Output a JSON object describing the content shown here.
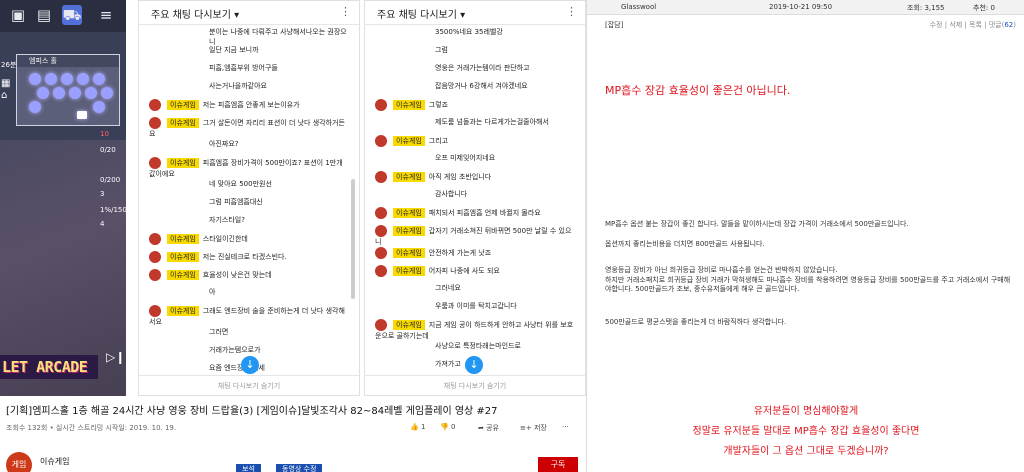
{
  "game": {
    "map_title": "엠피스 홀",
    "left_num": "26분",
    "side_values": [
      "10",
      "0/20",
      "0/200",
      "3",
      "1%/150",
      "4"
    ],
    "logo_text": "LET ARCADE",
    "accent": "#f4e27a"
  },
  "chat1": {
    "header": "주요 채팅 다시보기",
    "footer": "채팅 다시보기 숨기기",
    "messages": [
      {
        "name": "",
        "text": "분이는 나중에 다뤄주고 사냥해서나오는 권장으니"
      },
      {
        "name": "",
        "text": "일단 지금 보니까"
      },
      {
        "name": "",
        "text": "피흡,엠흡부위 방어구들"
      },
      {
        "name": "",
        "text": "사는거나을까같아요"
      },
      {
        "name": "이슈게임",
        "text": "저는 피흡엠흡 안좋게 보는이유가"
      },
      {
        "name": "이슈게임",
        "text": "그거 살돈이면 자리리 표션이 더 낫다 생각하거든요"
      },
      {
        "name": "",
        "text": "아진짜요?"
      },
      {
        "name": "이슈게임",
        "text": "피흡엠흡 장비가격이 500만이죠? 표션이 1만개값이에요"
      },
      {
        "name": "",
        "text": "네 맞아요 500만원선"
      },
      {
        "name": "",
        "text": "그럼 피흡엠흡대신"
      },
      {
        "name": "",
        "text": "자기스타일?"
      },
      {
        "name": "이슈게임",
        "text": "스타일이긴한데"
      },
      {
        "name": "이슈게임",
        "text": "저는 진실테크로 타겠스빈다."
      },
      {
        "name": "이슈게임",
        "text": "효율성이 낮은건 맞는데"
      },
      {
        "name": "",
        "text": "아"
      },
      {
        "name": "이슈게임",
        "text": "그래도 엔드장비 술을 준비하는게 더 낫다 생각해서요"
      },
      {
        "name": "",
        "text": "그러면"
      },
      {
        "name": "",
        "text": "거래가는템으로가"
      },
      {
        "name": "",
        "text": "요즘 엔드장비 시세"
      }
    ]
  },
  "chat2": {
    "header": "주요 채팅 다시보기",
    "footer": "채팅 다시보기 숨기기",
    "messages": [
      {
        "name": "",
        "text": "3500%네요 35레벨강"
      },
      {
        "name": "",
        "text": "그럼"
      },
      {
        "name": "",
        "text": "영웅은 거래가는템이라 판단하고"
      },
      {
        "name": "",
        "text": "잡음망거나 6강해서 겨야겠네요"
      },
      {
        "name": "이슈게임",
        "text": "그렇죠"
      },
      {
        "name": "",
        "text": "제도룸 넘돌과는 다르게가는걸줄아해서"
      },
      {
        "name": "이슈게임",
        "text": "그리고"
      },
      {
        "name": "",
        "text": "오프 미제잊어지네요"
      },
      {
        "name": "이슈게임",
        "text": "아직 게임 초반입니다"
      },
      {
        "name": "",
        "text": "감사합니다"
      },
      {
        "name": "이슈게임",
        "text": "패치되서 피흡엠흡 언제 바뀔지 몰라요"
      },
      {
        "name": "이슈게임",
        "text": "갑자기 거래소쳐진 뒤바뀌면 500만 날릴 수 있으니"
      },
      {
        "name": "이슈게임",
        "text": "안전하게 가는게 낫죠"
      },
      {
        "name": "이슈게임",
        "text": "어자피 나중에 사도 되요"
      },
      {
        "name": "",
        "text": "그러네요"
      },
      {
        "name": "",
        "text": "우룸과 이미를 탁치고갑니다"
      },
      {
        "name": "이슈게임",
        "text": "지금 게임 공이 하드하게 안하고 사냥터 위를 보호운으로 골하기는데"
      },
      {
        "name": "",
        "text": "사냥으로 특정타래는마인드로"
      },
      {
        "name": "",
        "text": "가져가고"
      }
    ]
  },
  "video": {
    "title": "[기획]엠피스홀 1층 해골 24시간 사냥 영웅 장비 드랍율(3) [게임이슈]달빛조각사 82~84레벨 게임플레이 영상 #27",
    "meta": "조회수 132회 • 실시간 스트리밍 시작일: 2019. 10. 19.",
    "likes": "1",
    "dislikes": "0",
    "share": "공유",
    "save": "저장",
    "more": "···",
    "channel_name": "이슈게임",
    "channel_avatar": "게임",
    "btn_a": "보석",
    "btn_b": "동영상 수정",
    "subscribe": "구독"
  },
  "post": {
    "author": "Glasswool",
    "date": "2019-10-21 09:50",
    "views": "조회: 3,155",
    "recommend": "추천: 0",
    "actions": [
      "수정",
      "삭제",
      "목록",
      "댓글"
    ],
    "comment_count": "62",
    "tag": "[잡담]",
    "headline": "MP흡수 장감 효율성이 좋은건 아닙니다.",
    "paragraphs": [
      "MP흡수 옵션 붙는 장갑이 좋긴 합니다. 말들을 맡이하시는데 장갑 가격이 거래소에서 500만골드입니다.",
      "옵션까지 좋리는비용을 더치면 800만골드 사용됩니다.",
      "영웅등급 장비가 아닌 희귀등급 장비로 마나흡수를 얻는건 반박하지 않았습니다.",
      "하지만 거래소패치로 희귀등급 장비 거래가 막혀생해도 마나흡수 장비를 착용하려면 영웅등급 장비를 500만골드를 주고 거래소에서 구매해야합니다. 500만골드가 조보, 중수유저들에게 해우 큰 골드입니다.",
      "500만골드로 평균스탯을 좋리는게 더 바람직하다 생각합니다."
    ],
    "closing": [
      "유저분들이 명심해야할게",
      "정말로 유저분들 말대로 MP흡수 장갑 효율성이 좋다면",
      "개발자들이 그 옵션 그대로 두겠습니까?"
    ],
    "accent": "#e0141e"
  }
}
